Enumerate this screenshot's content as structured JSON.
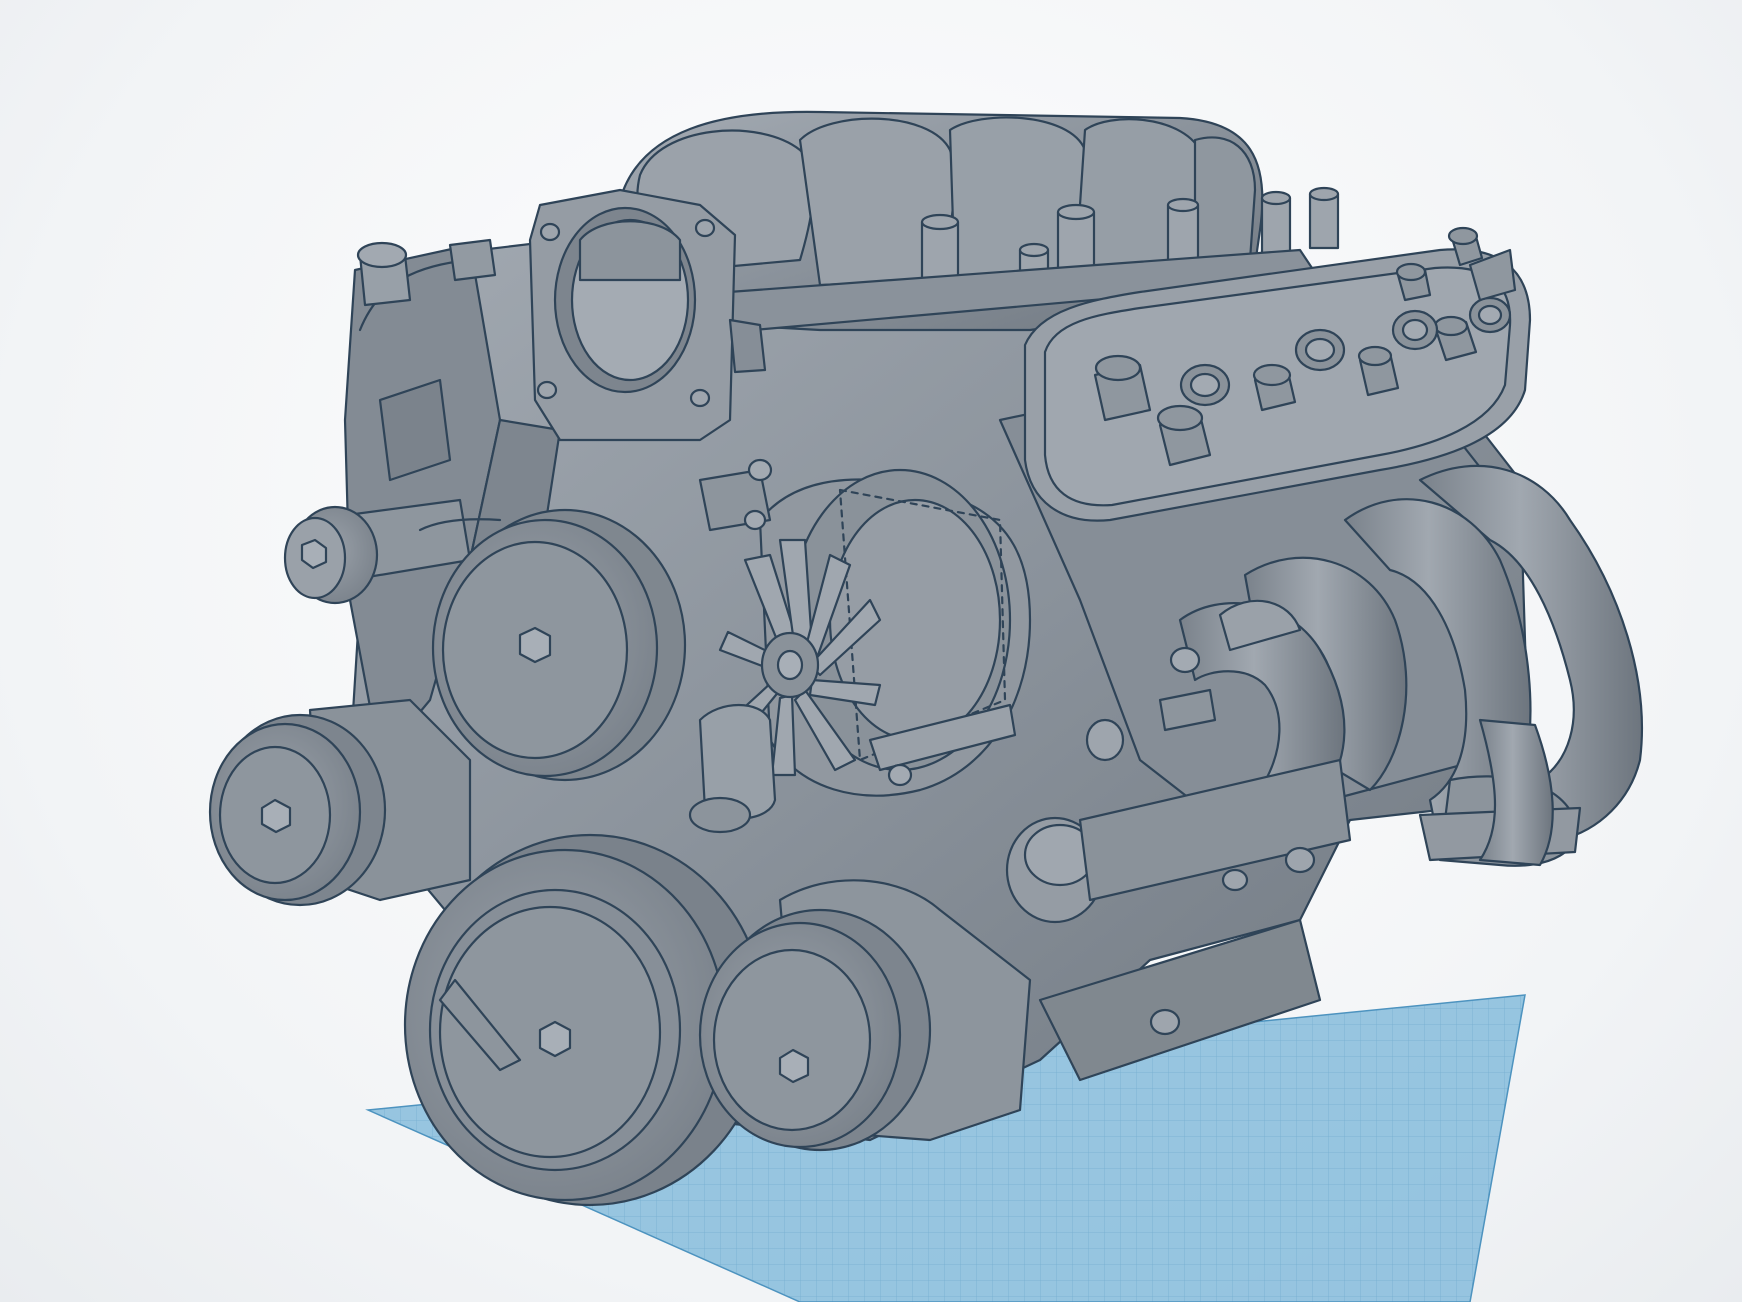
{
  "scene": {
    "model": "v8-engine",
    "colors": {
      "body": "#8c949d",
      "body_dark": "#737b84",
      "body_light": "#a6adb5",
      "outline": "#2f4458",
      "workplane": "#7fb7d8",
      "workplane_grid": "#5a9dc4",
      "background": "#f3f5f7"
    },
    "components": [
      "workplane-grid",
      "intake-manifold",
      "throttle-body",
      "valve-cover",
      "exhaust-headers",
      "alternator",
      "water-pump-pulley",
      "crank-pulley",
      "ac-compressor-pulley",
      "power-steering-pulley",
      "idler-pulley",
      "timing-cover"
    ]
  }
}
